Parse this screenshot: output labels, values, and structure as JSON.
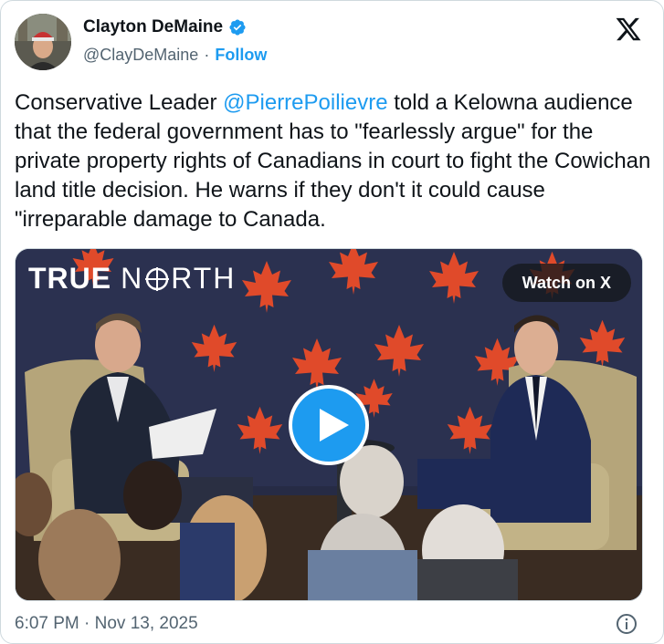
{
  "author": {
    "display_name": "Clayton DeMaine",
    "handle": "@ClayDeMaine",
    "separator": "·",
    "follow_label": "Follow",
    "verified_icon": "verified-badge-icon"
  },
  "tweet": {
    "text_before": "Conservative Leader ",
    "mention": "@PierrePoilievre",
    "text_after": " told a Kelowna audience that the federal government has to \"fearlessly argue\" for the private property rights of Canadians in court to fight the Cowichan land title decision. He warns if they don't it could cause \"irreparable damage to Canada."
  },
  "media": {
    "brand_true": "TRUE",
    "brand_north_a": "N",
    "brand_north_b": "RTH",
    "watch_label": "Watch on X",
    "play_icon": "play-icon"
  },
  "footer": {
    "timestamp": "6:07 PM · Nov 13, 2025",
    "info_icon": "info-icon"
  },
  "colors": {
    "link": "#1d9bf0",
    "secondary_text": "#536471",
    "border": "#cfd9de"
  }
}
